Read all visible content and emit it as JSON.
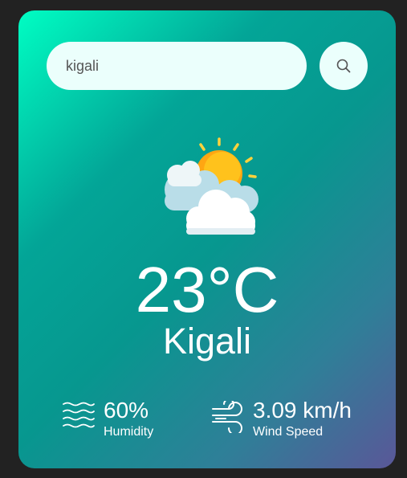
{
  "search": {
    "value": "kigali",
    "button_icon": "search-icon"
  },
  "weather": {
    "icon": "partly-cloudy-icon",
    "temperature": "23°C",
    "city": "Kigali"
  },
  "details": {
    "humidity": {
      "value": "60%",
      "label": "Humidity",
      "icon": "humidity-waves-icon"
    },
    "wind": {
      "value": "3.09 km/h",
      "label": "Wind Speed",
      "icon": "wind-icon"
    }
  },
  "colors": {
    "page_background": "#222222",
    "gradient_start": "#00fec3",
    "gradient_end": "#5a5798",
    "input_background": "#ebfffc",
    "text": "#ffffff"
  }
}
